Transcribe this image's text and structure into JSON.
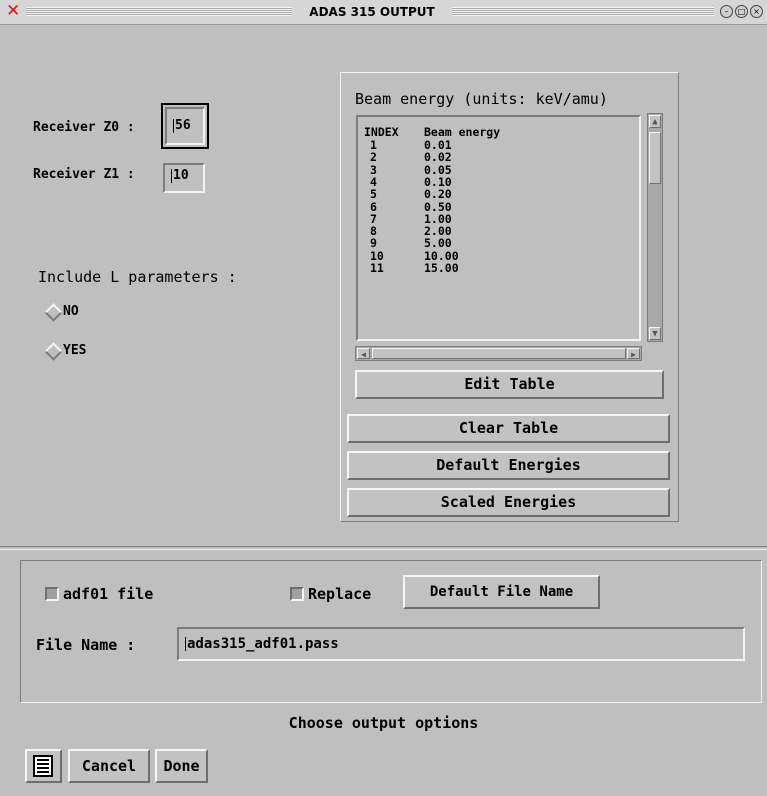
{
  "window": {
    "title": "ADAS 315 OUTPUT"
  },
  "receiver": {
    "z0_label": "Receiver Z0 :",
    "z0_value": "56",
    "z1_label": "Receiver Z1 :",
    "z1_value": "10"
  },
  "lparams": {
    "label": "Include L parameters :",
    "options": [
      "NO",
      "YES"
    ]
  },
  "beam": {
    "title": "Beam energy (units: keV/amu)",
    "header_index": "INDEX",
    "header_energy": "Beam energy",
    "rows": [
      {
        "index": "1",
        "energy": "0.01"
      },
      {
        "index": "2",
        "energy": "0.02"
      },
      {
        "index": "3",
        "energy": "0.05"
      },
      {
        "index": "4",
        "energy": "0.10"
      },
      {
        "index": "5",
        "energy": "0.20"
      },
      {
        "index": "6",
        "energy": "0.50"
      },
      {
        "index": "7",
        "energy": "1.00"
      },
      {
        "index": "8",
        "energy": "2.00"
      },
      {
        "index": "9",
        "energy": "5.00"
      },
      {
        "index": "10",
        "energy": "10.00"
      },
      {
        "index": "11",
        "energy": "15.00"
      }
    ],
    "edit_label": "Edit Table",
    "clear_label": "Clear Table",
    "default_label": "Default Energies",
    "scaled_label": "Scaled Energies"
  },
  "file": {
    "adf01_label": "adf01 file",
    "replace_label": "Replace",
    "default_name_label": "Default File Name",
    "name_label": "File Name :",
    "name_value": "adas315_adf01.pass"
  },
  "status": {
    "message": "Choose output options"
  },
  "footer": {
    "cancel_label": "Cancel",
    "done_label": "Done"
  }
}
